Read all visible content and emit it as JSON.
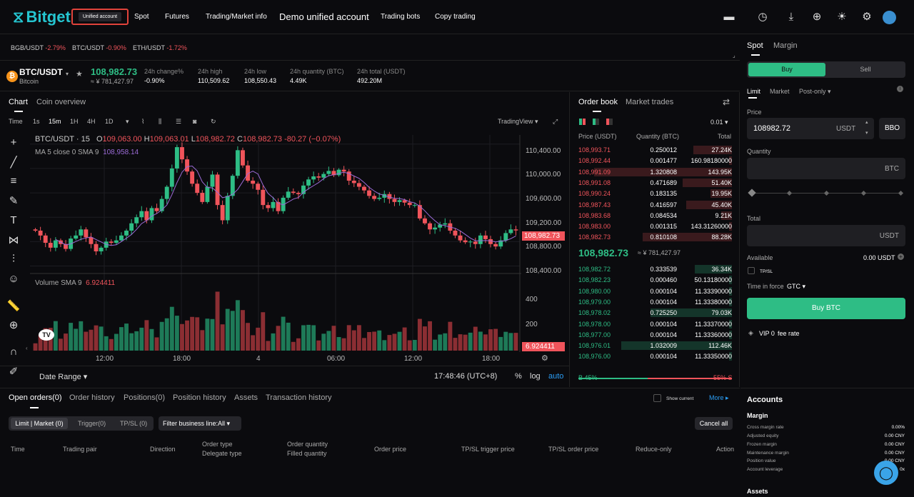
{
  "nav": {
    "logo": "Bitget",
    "unified": "Unified account",
    "spot": "Spot",
    "futures": "Futures",
    "trading_market": "Trading/Market info",
    "demo": "Demo unified account",
    "bots": "Trading bots",
    "copy": "Copy trading"
  },
  "ticker": [
    {
      "pair": "BGB/USDT",
      "chg": "-2.79%"
    },
    {
      "pair": "BTC/USDT",
      "chg": "-0.90%"
    },
    {
      "pair": "ETH/USDT",
      "chg": "-1.72%"
    }
  ],
  "header": {
    "symbol": "BTC/USDT",
    "name": "Bitcoin",
    "price": "108,982.73",
    "price_cny": "≈ ¥ 781,427.97",
    "stats": [
      {
        "label": "24h change%",
        "value": "-0.90%"
      },
      {
        "label": "24h high",
        "value": "110,509.62"
      },
      {
        "label": "24h low",
        "value": "108,550.43"
      },
      {
        "label": "24h quantity (BTC)",
        "value": "4.49K"
      },
      {
        "label": "24h total (USDT)",
        "value": "492.20M"
      }
    ]
  },
  "chart": {
    "tab_chart": "Chart",
    "tab_coin": "Coin overview",
    "intervals": [
      "Time",
      "1s",
      "15m",
      "1H",
      "4H",
      "1D"
    ],
    "tradingview": "TradingView",
    "ohlc_title": "BTC/USDT · 15",
    "o": "O",
    "o_val": "109,063.00",
    "h": "H",
    "h_val": "109,063.01",
    "l": "L",
    "l_val": "108,982.72",
    "c": "C",
    "c_val": "108,982.73",
    "change": "-80.27 (−0.07%)",
    "ma": "MA 5 close 0 SMA 9",
    "ma_val": "108,958.14",
    "vol": "Volume SMA 9",
    "vol_val": "6.924411",
    "price_ticks": [
      "110,400.00",
      "110,000.00",
      "109,600.00",
      "109,200.00",
      "108,800.00",
      "108,400.00"
    ],
    "last_price": "108,982.73",
    "vol_ticks": [
      "400",
      "200"
    ],
    "vol_last": "6.924411",
    "time_ticks": [
      "12:00",
      "18:00",
      "4",
      "06:00",
      "12:00",
      "18:00"
    ],
    "date_range": "Date Range",
    "clock": "17:48:46 (UTC+8)",
    "pct": "%",
    "log": "log",
    "auto": "auto"
  },
  "chart_data": {
    "type": "candlestick",
    "title": "BTC/USDT · 15",
    "interval": "15m",
    "ylim": [
      108300,
      110550
    ],
    "x_ticks": [
      "12:00",
      "18:00",
      "4",
      "06:00",
      "12:00",
      "18:00"
    ],
    "close": [
      108980,
      108900,
      108780,
      108700,
      108820,
      108760,
      108680,
      108850,
      108900,
      109000,
      108870,
      108760,
      108640,
      108700,
      108800,
      108780,
      108820,
      108900,
      108980,
      109100,
      109200,
      109300,
      109150,
      109350,
      109300,
      109500,
      109700,
      110000,
      110350,
      110150,
      109950,
      109750,
      109600,
      109450,
      109700,
      109900,
      109400,
      109150,
      109550,
      109880,
      110300,
      110050,
      109800,
      109750,
      109650,
      109400,
      109350,
      109450,
      109300,
      109520,
      109620,
      109600,
      109580,
      109720,
      109820,
      109870,
      109850,
      109910,
      109960,
      109890,
      109980,
      109950,
      109800,
      109760,
      109700,
      109640,
      109550,
      109500,
      109520,
      109580,
      109500,
      109450,
      109480,
      109440,
      109400,
      109400,
      109180,
      109100,
      109000,
      109030,
      109080,
      109100,
      108980,
      108900,
      108820,
      108790,
      108800,
      108760,
      108900,
      108840,
      108760,
      108720,
      108820,
      108940,
      109000,
      108983
    ],
    "volume_ticks": [
      400,
      200
    ],
    "last_volume": 6.924411,
    "ma_value": 108958.14
  },
  "book": {
    "tab_book": "Order book",
    "tab_trades": "Market trades",
    "precision": "0.01",
    "h_price": "Price (USDT)",
    "h_qty": "Quantity (BTC)",
    "h_total": "Total",
    "asks": [
      [
        "108,993.71",
        "0.250012",
        "27.24K"
      ],
      [
        "108,992.44",
        "0.001477",
        "160.98180000"
      ],
      [
        "108,991.09",
        "1.320808",
        "143.95K"
      ],
      [
        "108,991.08",
        "0.471689",
        "51.40K"
      ],
      [
        "108,990.24",
        "0.183135",
        "19.95K"
      ],
      [
        "108,987.43",
        "0.416597",
        "45.40K"
      ],
      [
        "108,983.68",
        "0.084534",
        "9.21K"
      ],
      [
        "108,983.00",
        "0.001315",
        "143.31260000"
      ],
      [
        "108,982.73",
        "0.810108",
        "88.28K"
      ]
    ],
    "ask_depth": [
      0.25,
      0.02,
      0.9,
      0.32,
      0.14,
      0.3,
      0.07,
      0.02,
      0.58
    ],
    "mid": "108,982.73",
    "mid_cny": "≈ ¥ 781,427.97",
    "bids": [
      [
        "108,982.72",
        "0.333539",
        "36.34K"
      ],
      [
        "108,982.23",
        "0.000460",
        "50.13180000"
      ],
      [
        "108,980.00",
        "0.000104",
        "11.33390000"
      ],
      [
        "108,979.00",
        "0.000104",
        "11.33380000"
      ],
      [
        "108,978.02",
        "0.725250",
        "79.03K"
      ],
      [
        "108,978.00",
        "0.000104",
        "11.33370000"
      ],
      [
        "108,977.00",
        "0.000104",
        "11.33360000"
      ],
      [
        "108,976.01",
        "1.032009",
        "112.46K"
      ],
      [
        "108,976.00",
        "0.000104",
        "11.33350000"
      ]
    ],
    "bid_depth": [
      0.24,
      0.02,
      0.02,
      0.02,
      0.53,
      0.02,
      0.02,
      0.72,
      0.02
    ],
    "buy_pct": "B 45%",
    "sell_pct": "55% S",
    "buy_frac": 0.45
  },
  "order": {
    "tab_spot": "Spot",
    "tab_margin": "Margin",
    "buy": "Buy",
    "sell": "Sell",
    "limit": "Limit",
    "market": "Market",
    "post": "Post-only",
    "price_label": "Price",
    "price_val": "108982.72",
    "usdt": "USDT",
    "bbo": "BBO",
    "qty_label": "Quantity",
    "btc": "BTC",
    "total_label": "Total",
    "available": "Available",
    "available_val": "0.00 USDT",
    "tpsl": "TP/SL",
    "tif": "Time in force",
    "gtc": "GTC",
    "buy_btc": "Buy BTC",
    "vip": "VIP 0",
    "fee": "fee rate"
  },
  "bottom": {
    "tabs": [
      "Open orders(0)",
      "Order history",
      "Positions(0)",
      "Position history",
      "Assets",
      "Transaction history"
    ],
    "show_current": "Show current",
    "more": "More",
    "subtabs": [
      "Limit | Market (0)",
      "Trigger(0)",
      "TP/SL (0)"
    ],
    "filter": "Filter business line:All",
    "cancel_all": "Cancel all",
    "cols": [
      "Time",
      "Trading pair",
      "Direction",
      "Order type",
      "Delegate type",
      "Order quantity",
      "Filled quantity",
      "Order price",
      "TP/SL trigger price",
      "TP/SL order price",
      "Reduce-only",
      "Action"
    ]
  },
  "accounts": {
    "title": "Accounts",
    "margin": "Margin",
    "rows": [
      [
        "Cross margin rate",
        "0.00%"
      ],
      [
        "Adjusted equity",
        "0.00 CNY"
      ],
      [
        "Frozen margin",
        "0.00 CNY"
      ],
      [
        "Maintenance margin",
        "0.00 CNY"
      ],
      [
        "Position value",
        "0.00 CNY"
      ],
      [
        "Account leverage",
        "0x"
      ]
    ],
    "assets": "Assets"
  },
  "colors": {
    "green": "#2ebd85",
    "red": "#f0545b",
    "accent": "#25c5d0",
    "bg": "#0b0b0e"
  }
}
